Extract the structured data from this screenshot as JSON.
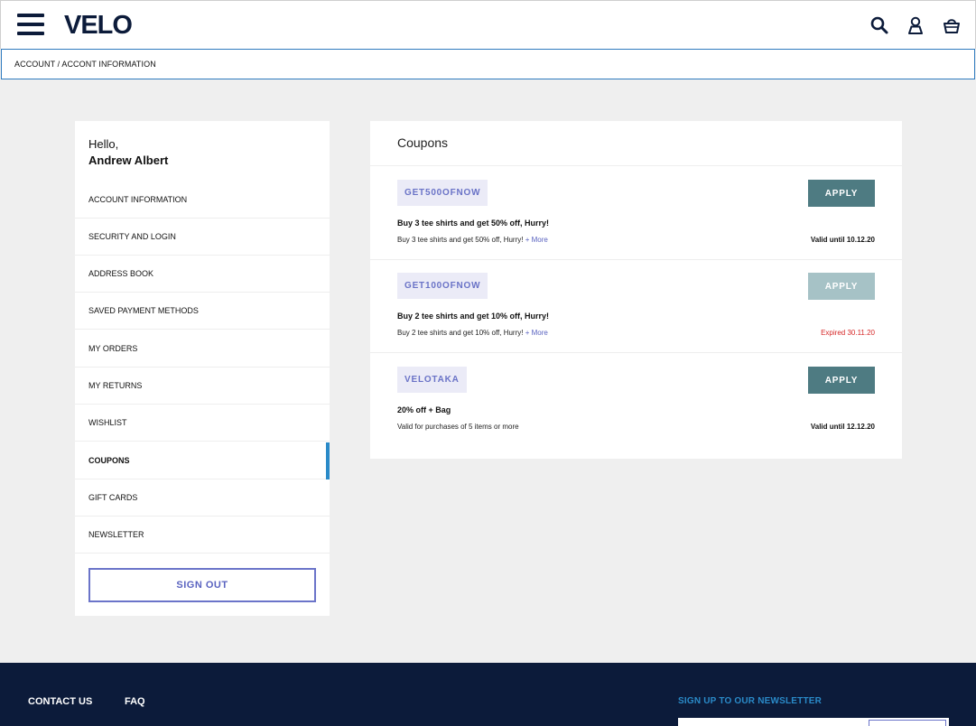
{
  "header": {
    "logo": "VELO",
    "icons": [
      "menu-icon",
      "search-icon",
      "user-icon",
      "shopping-bag-icon"
    ]
  },
  "breadcrumb": "ACCOUNT / ACCONT INFORMATION",
  "sidebar": {
    "greeting": "Hello,",
    "user_name": "Andrew Albert",
    "items": [
      {
        "label": "ACCOUNT INFORMATION"
      },
      {
        "label": "SECURITY AND LOGIN"
      },
      {
        "label": "ADDRESS BOOK"
      },
      {
        "label": "SAVED PAYMENT METHODS"
      },
      {
        "label": "MY ORDERS"
      },
      {
        "label": "MY RETURNS"
      },
      {
        "label": "WISHLIST"
      },
      {
        "label": "COUPONS"
      },
      {
        "label": "GIFT CARDS"
      },
      {
        "label": "NEWSLETTER"
      }
    ],
    "active_item": "COUPONS",
    "sign_out_label": "SIGN OUT"
  },
  "coupons": {
    "title": "Coupons",
    "items": [
      {
        "code": "GET500OFNOW",
        "apply_label": "APPLY",
        "headline": "Buy 3 tee shirts and get 50% off, Hurry!",
        "description": "Buy 3 tee shirts and get 50% off, Hurry!",
        "more_label": "+ More",
        "validity": "Valid until 10.12.20"
      },
      {
        "code": "GET100OFNOW",
        "apply_label": "APPLY",
        "headline": "Buy 2 tee shirts and get 10% off, Hurry!",
        "description": "Buy 2 tee shirts and get 10% off, Hurry!",
        "more_label": "+ More",
        "validity": "Expired 30.11.20"
      },
      {
        "code": "VELOTAKA",
        "apply_label": "APPLY",
        "headline": "20% off + Bag",
        "description": "Valid for purchases of 5 items or more",
        "validity": "Valid until 12.12.20"
      }
    ]
  },
  "footer": {
    "contact_label": "CONTACT US",
    "faq_label": "FAQ",
    "newsletter_label": "SIGN UP TO OUR NEWSLETTER"
  },
  "colors": {
    "brand_navy": "#0c1b3a",
    "accent_blue": "#2a8ac8",
    "apply_teal": "#4e7b82",
    "apply_disabled": "#a6c2c6",
    "code_text": "#6a73c7",
    "expired_red": "#d62828"
  }
}
